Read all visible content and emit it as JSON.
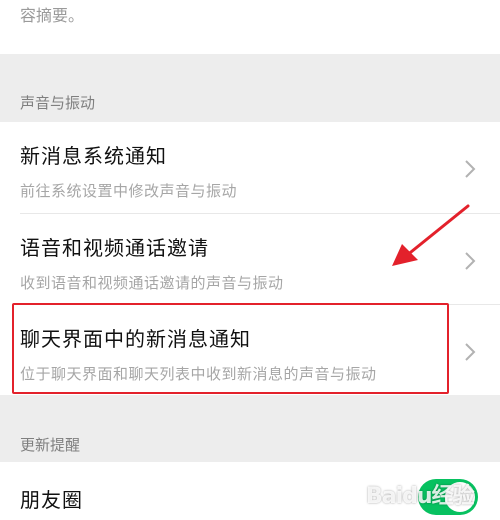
{
  "top": {
    "partial_text": "容摘要。"
  },
  "sections": {
    "sound_vibration": {
      "header": "声音与振动",
      "items": [
        {
          "title": "新消息系统通知",
          "subtitle": "前往系统设置中修改声音与振动"
        },
        {
          "title": "语音和视频通话邀请",
          "subtitle": "收到语音和视频通话邀请的声音与振动"
        },
        {
          "title": "聊天界面中的新消息通知",
          "subtitle": "位于聊天界面和聊天列表中收到新消息的声音与振动"
        }
      ]
    },
    "update_reminder": {
      "header": "更新提醒",
      "items": [
        {
          "title": "朋友圈",
          "toggle_on": true
        }
      ]
    }
  },
  "watermark": "Baidu经验",
  "colors": {
    "accent_green": "#07c160",
    "highlight_red": "#e3212b",
    "background": "#ededed"
  },
  "icons": {
    "chevron": "chevron-right-icon",
    "arrow": "red-arrow-annotation"
  }
}
